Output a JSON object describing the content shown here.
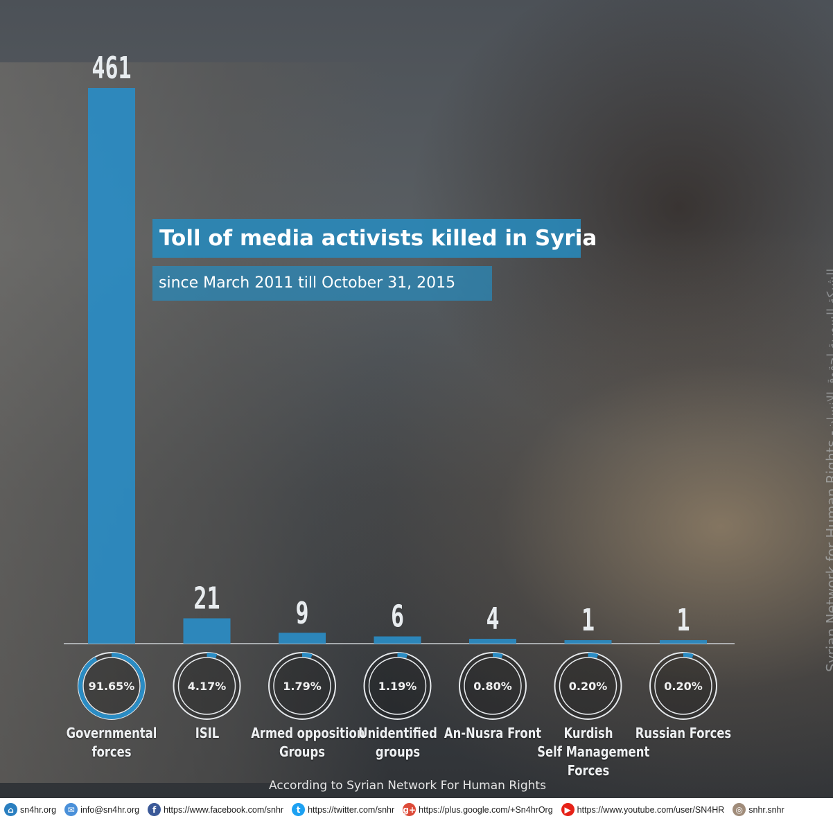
{
  "title": "Toll of media activists killed in Syria",
  "subtitle": "since March  2011 till October 31, 2015",
  "source": "According to Syrian Network For Human Rights",
  "watermark": "Syrian Network for Human Rights -",
  "watermark_ar": "الشبكة السورية لحقوق الإنسان",
  "colors": {
    "bar": "#2a8cc4",
    "ring": "#2a8cc4",
    "title_bg": "#288abc",
    "footer_bg": "#ffffff"
  },
  "chart_data": {
    "type": "bar",
    "categories": [
      "Governmental forces",
      "ISIL",
      "Armed opposition Groups",
      "Unidentified groups",
      "An-Nusra Front",
      "Kurdish Self Management Forces",
      "Russian Forces"
    ],
    "category_lines": [
      [
        "Governmental",
        "forces"
      ],
      [
        "ISIL"
      ],
      [
        "Armed opposition",
        "Groups"
      ],
      [
        "Unidentified",
        "groups"
      ],
      [
        "An-Nusra Front"
      ],
      [
        "Kurdish",
        "Self Management",
        "Forces"
      ],
      [
        "Russian Forces"
      ]
    ],
    "values": [
      461,
      21,
      9,
      6,
      4,
      1,
      1
    ],
    "percentages": [
      91.65,
      4.17,
      1.79,
      1.19,
      0.8,
      0.2,
      0.2
    ],
    "percentage_labels": [
      "91.65%",
      "4.17%",
      "1.79%",
      "1.19%",
      "0.80%",
      "0.20%",
      "0.20%"
    ],
    "ylim": [
      0,
      461
    ],
    "grid": false,
    "legend": "none"
  },
  "footer": [
    {
      "icon": "home-icon",
      "color": "#2a7fc0",
      "glyph": "⌂",
      "text": "sn4hr.org"
    },
    {
      "icon": "mail-icon",
      "color": "#4a90d9",
      "glyph": "✉",
      "text": "info@sn4hr.org"
    },
    {
      "icon": "facebook-icon",
      "color": "#3b5998",
      "glyph": "f",
      "text": "https://www.facebook.com/snhr"
    },
    {
      "icon": "twitter-icon",
      "color": "#1da1f2",
      "glyph": "t",
      "text": "https://twitter.com/snhr"
    },
    {
      "icon": "google-plus-icon",
      "color": "#dd4b39",
      "glyph": "g+",
      "text": "https://plus.google.com/+Sn4hrOrg"
    },
    {
      "icon": "youtube-icon",
      "color": "#e62117",
      "glyph": "▶",
      "text": "https://www.youtube.com/user/SN4HR"
    },
    {
      "icon": "instagram-icon",
      "color": "#a08c7a",
      "glyph": "◎",
      "text": "snhr.snhr"
    }
  ]
}
